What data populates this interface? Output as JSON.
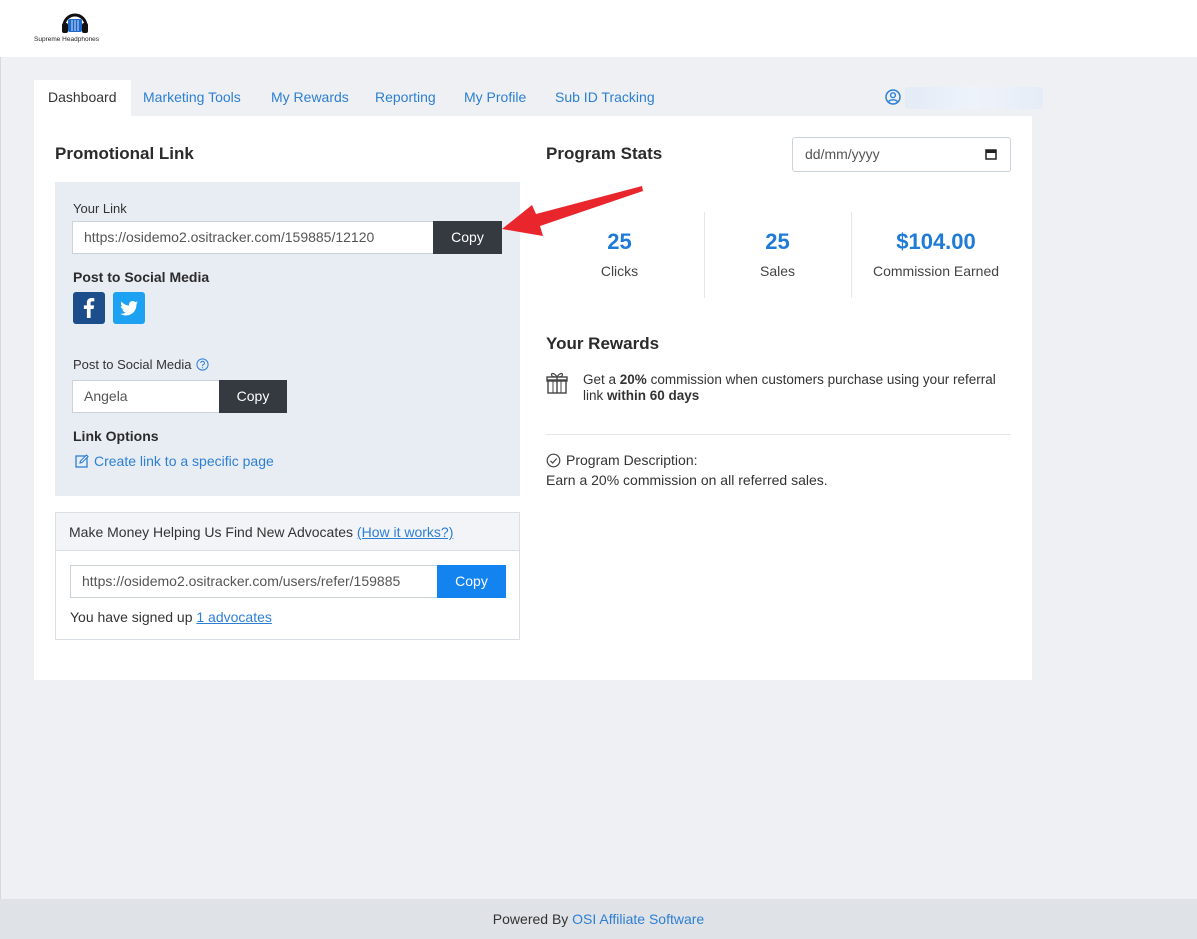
{
  "brand": {
    "logo_text": "Supreme Headphones",
    "logo_icon": "headphones-icon"
  },
  "tabs": [
    {
      "label": "Dashboard",
      "active": true
    },
    {
      "label": "Marketing Tools"
    },
    {
      "label": "My Rewards"
    },
    {
      "label": "Reporting"
    },
    {
      "label": "My Profile"
    },
    {
      "label": "Sub ID Tracking"
    }
  ],
  "user": {
    "icon": "user-circle-icon"
  },
  "promotional": {
    "title": "Promotional Link",
    "your_link_label": "Your Link",
    "your_link_value": "https://osidemo2.ositracker.com/159885/12120",
    "copy_label": "Copy",
    "social_label": "Post to Social Media",
    "social_icons": [
      "facebook-icon",
      "twitter-icon"
    ],
    "coupon_label": "Post to Social Media",
    "coupon_value": "Angela",
    "coupon_copy_label": "Copy",
    "link_options_label": "Link Options",
    "create_link_label": "Create link to a specific page"
  },
  "advocates": {
    "heading": "Make Money Helping Us Find New Advocates",
    "how_it_works": "(How it works?)",
    "refer_link": "https://osidemo2.ositracker.com/users/refer/159885",
    "copy_label": "Copy",
    "signed_up_prefix": "You have signed up",
    "signed_up_link": "1 advocates"
  },
  "stats": {
    "title": "Program Stats",
    "date_placeholder": "dd/mm/yyyy",
    "items": [
      {
        "value": "25",
        "caption": "Clicks"
      },
      {
        "value": "25",
        "caption": "Sales"
      },
      {
        "value": "$104.00",
        "caption": "Commission Earned"
      }
    ]
  },
  "rewards": {
    "title": "Your Rewards",
    "pre": "Get a ",
    "percent": "20%",
    "mid": " commission when customers purchase using your referral link ",
    "window": "within 60 days"
  },
  "description": {
    "title": "Program Description:",
    "text": "Earn a 20% commission on all referred sales."
  },
  "footer": {
    "prefix": "Powered By ",
    "link": "OSI Affiliate Software"
  },
  "colors": {
    "accent": "#2d7fd4",
    "dark_button": "#343a40",
    "blue_button": "#1283ef",
    "annotation_arrow": "#e8262b"
  }
}
